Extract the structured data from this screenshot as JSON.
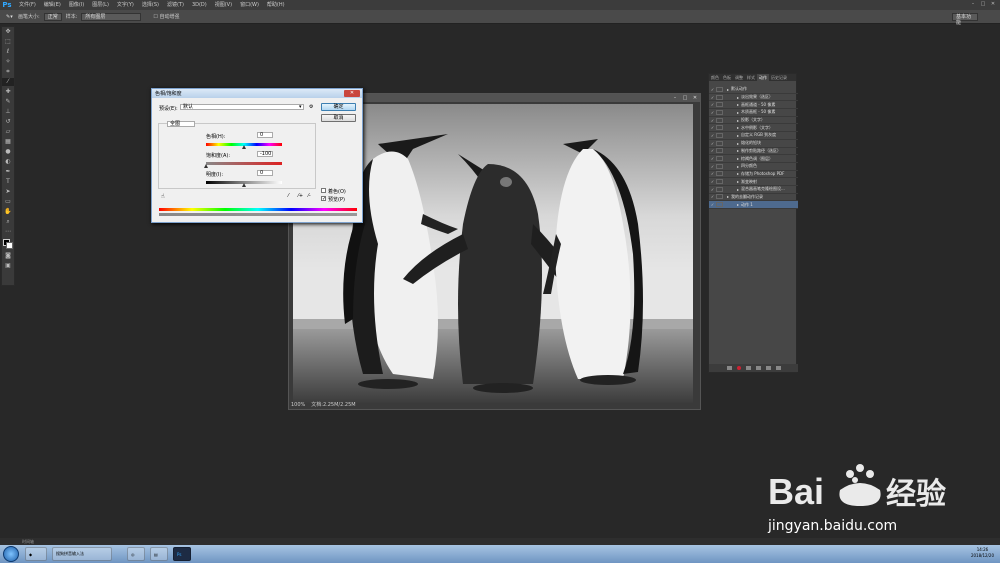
{
  "app": {
    "logo": "Ps"
  },
  "menu": [
    "文件(F)",
    "编辑(E)",
    "图像(I)",
    "图层(L)",
    "文字(Y)",
    "选择(S)",
    "滤镜(T)",
    "3D(D)",
    "视图(V)",
    "窗口(W)",
    "帮助(H)"
  ],
  "options": {
    "size_label": "画笔大小:",
    "mode_label": "模式:",
    "mode": "正常",
    "opacity_label": "样本:",
    "sample": "所有图层",
    "checkbox": "自动增强",
    "workspace": "基本功能"
  },
  "window": {
    "min": "–",
    "max": "□",
    "close": "✕"
  },
  "document": {
    "zoom": "100%",
    "info": "文档:2.25M/2.25M"
  },
  "dialog": {
    "title": "色相/饱和度",
    "preset_label": "预设(E):",
    "preset": "默认",
    "ok": "确定",
    "cancel": "取消",
    "channel": "全图",
    "hue_label": "色相(H):",
    "hue": "0",
    "sat_label": "饱和度(A):",
    "sat": "-100",
    "light_label": "明度(I):",
    "light": "0",
    "colorize": "着色(O)",
    "preview": "预览(P)"
  },
  "panel": {
    "tabs": [
      "颜色",
      "色板",
      "调整",
      "样式",
      "动作",
      "历史记录"
    ],
    "active_tab": "动作",
    "rows": [
      {
        "label": "默认动作",
        "level": 0
      },
      {
        "label": "淡出效果（选区）",
        "level": 1
      },
      {
        "label": "画框通道 - 50 像素",
        "level": 1
      },
      {
        "label": "木质画框 - 50 像素",
        "level": 1
      },
      {
        "label": "投影（文字）",
        "level": 1
      },
      {
        "label": "水中倒影（文字）",
        "level": 1
      },
      {
        "label": "自定义 RGB 到灰度",
        "level": 1
      },
      {
        "label": "熔化的铅块",
        "level": 1
      },
      {
        "label": "制作剪贴路径（选区）",
        "level": 1
      },
      {
        "label": "棕褐色调（图层）",
        "level": 1
      },
      {
        "label": "四分颜色",
        "level": 1
      },
      {
        "label": "存储为 Photoshop PDF",
        "level": 1
      },
      {
        "label": "渐变映射",
        "level": 1
      },
      {
        "label": "混合器画笔克隆绘图设...",
        "level": 1
      },
      {
        "label": "我的去翻动作记录",
        "level": 0
      },
      {
        "label": "动作 1",
        "level": 1
      }
    ],
    "selected_row": 15
  },
  "statusbar": {
    "text": "时间轴"
  },
  "taskbar": {
    "items": [
      "搜狗拼音输入法",
      "",
      ""
    ],
    "time": "14:26",
    "date": "2018/12/20"
  },
  "watermark": {
    "text": "jingyan.baidu.com"
  }
}
